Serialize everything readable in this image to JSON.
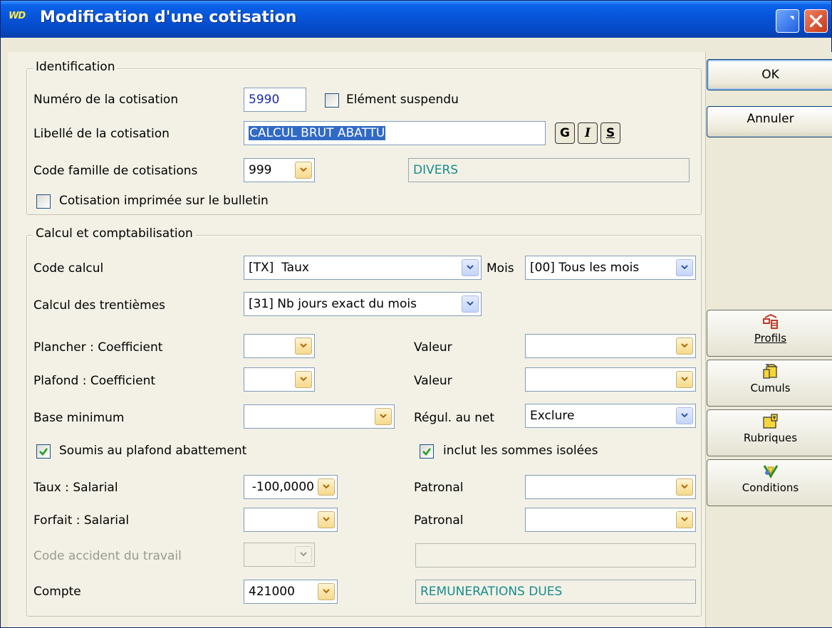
{
  "window": {
    "app_icon": "WD",
    "title": "Modification d'une cotisation"
  },
  "identification": {
    "legend": "Identification",
    "numero_label": "Numéro de la cotisation",
    "numero_value": "5990",
    "suspendu_label": "Elément suspendu",
    "suspendu_checked": false,
    "libelle_label": "Libellé de la cotisation",
    "libelle_value": "CALCUL BRUT ABATTU",
    "format_bold": "G",
    "format_italic": "I",
    "format_underline": "S",
    "famille_label": "Code famille de cotisations",
    "famille_code": "999",
    "famille_libelle": "DIVERS",
    "imprimee_label": "Cotisation imprimée sur le bulletin",
    "imprimee_checked": false
  },
  "calcul": {
    "legend": "Calcul et comptabilisation",
    "code_calcul_label": "Code calcul",
    "code_calcul_value": "[TX]  Taux",
    "mois_label": "Mois",
    "mois_value": "[00] Tous les mois",
    "trentiemes_label": "Calcul des trentièmes",
    "trentiemes_value": "[31] Nb jours exact du mois",
    "plancher_label": "Plancher : Coefficient",
    "plancher_coef": "",
    "plancher_valeur_label": "Valeur",
    "plancher_valeur": "",
    "plafond_label": "Plafond  : Coefficient",
    "plafond_coef": "",
    "plafond_valeur_label": "Valeur",
    "plafond_valeur": "",
    "base_min_label": "Base minimum",
    "base_min_value": "",
    "regul_label": "Régul. au net",
    "regul_value": "Exclure",
    "soumis_label": "Soumis au plafond abattement",
    "soumis_checked": true,
    "inclut_label": "inclut les sommes isolées",
    "inclut_checked": true,
    "taux_label": "Taux  : Salarial",
    "taux_salarial": "-100,0000",
    "taux_patronal_label": "Patronal",
    "taux_patronal": "",
    "forfait_label": "Forfait : Salarial",
    "forfait_salarial": "",
    "forfait_patronal_label": "Patronal",
    "forfait_patronal": "",
    "accident_label": "Code accident du travail",
    "accident_code": "",
    "accident_libelle": "",
    "compte_label": "Compte",
    "compte_value": "421000",
    "compte_libelle": "REMUNERATIONS DUES"
  },
  "buttons": {
    "ok": "OK",
    "annuler": "Annuler"
  },
  "tools": [
    {
      "label": "Profils",
      "icon": "profiles-icon"
    },
    {
      "label": "Cumuls",
      "icon": "cumuls-icon"
    },
    {
      "label": "Rubriques",
      "icon": "rubriques-icon"
    },
    {
      "label": "Conditions",
      "icon": "conditions-icon"
    }
  ],
  "colors": {
    "titlebar": "#0654d8",
    "selection": "#316ac5",
    "teal_text": "#178c8c",
    "blue_text": "#1b2aa8",
    "check_green": "#21a121"
  }
}
